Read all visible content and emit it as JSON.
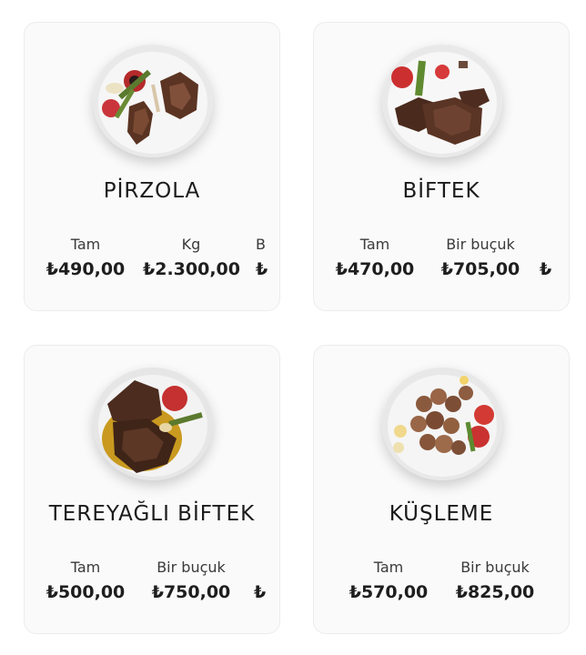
{
  "items": [
    {
      "name": "PİRZOLA",
      "prices": [
        {
          "label": "Tam",
          "value": "₺490,00"
        },
        {
          "label": "Kg",
          "value": "₺2.300,00"
        },
        {
          "label": "B",
          "value": "₺"
        }
      ]
    },
    {
      "name": "BİFTEK",
      "prices": [
        {
          "label": "Tam",
          "value": "₺470,00"
        },
        {
          "label": "Bir buçuk",
          "value": "₺705,00"
        },
        {
          "label": "",
          "value": "₺"
        }
      ]
    },
    {
      "name": "TEREYAĞLI BİFTEK",
      "prices": [
        {
          "label": "Tam",
          "value": "₺500,00"
        },
        {
          "label": "Bir buçuk",
          "value": "₺750,00"
        },
        {
          "label": "",
          "value": "₺"
        }
      ]
    },
    {
      "name": "KÜŞLEME",
      "prices": [
        {
          "label": "Tam",
          "value": "₺570,00"
        },
        {
          "label": "Bir buçuk",
          "value": "₺825,00"
        }
      ]
    }
  ]
}
